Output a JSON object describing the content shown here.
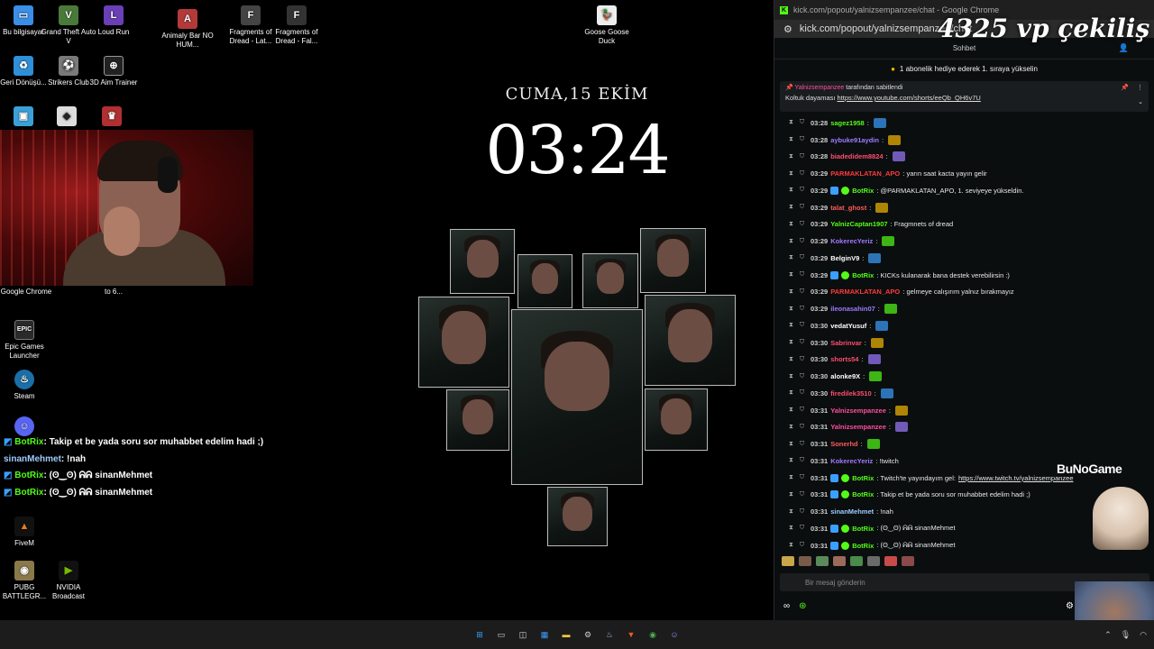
{
  "desktop_icons": [
    {
      "label": "Bu bilgisayar",
      "icon": "computer-icon",
      "color": "#3a8ee6"
    },
    {
      "label": "Grand Theft Auto V",
      "icon": "gta-icon",
      "color": "#4a7a3a"
    },
    {
      "label": "Loud Run",
      "icon": "loud-run-icon",
      "color": "#6b3fb6"
    },
    {
      "label": "Animaly Bar NO HUM...",
      "icon": "animaly-bar-icon",
      "color": "#b43a3a"
    },
    {
      "label": "Fragments of Dread - Lat...",
      "icon": "fragments-icon",
      "color": "#444"
    },
    {
      "label": "Fragments of Dread - Fal...",
      "icon": "fragments-icon",
      "color": "#333"
    },
    {
      "label": "Goose Goose Duck",
      "icon": "goose-icon",
      "color": "#eeeeee"
    },
    {
      "label": "Geri Dönüşü...",
      "icon": "recycle-bin-icon",
      "color": "#2f8fd8"
    },
    {
      "label": "Strikers Club",
      "icon": "strikers-club-icon",
      "color": "#7a7a7a"
    },
    {
      "label": "3D Aim Trainer",
      "icon": "aim-trainer-icon",
      "color": "#222"
    },
    {
      "label": "Google Chrome",
      "icon": "chrome-icon",
      "color": "#4285f4"
    },
    {
      "label": "to 6...",
      "icon": "file-icon",
      "color": "#555"
    },
    {
      "label": "Epic Games Launcher",
      "icon": "epic-icon",
      "color": "#2a2a2a"
    },
    {
      "label": "Steam",
      "icon": "steam-icon",
      "color": "#1b6fa8"
    },
    {
      "label": "FiveM",
      "icon": "fivem-icon",
      "color": "#e67e22"
    },
    {
      "label": "PUBG BATTLEGR...",
      "icon": "pubg-icon",
      "color": "#8a7a4a"
    },
    {
      "label": "NVIDIA Broadcast",
      "icon": "nvidia-icon",
      "color": "#76b900"
    }
  ],
  "overlay_chat": [
    {
      "user": "BotRix",
      "text": ": Takip et be yada soru sor muhabbet edelim hadi ;)"
    },
    {
      "user": "sinanMehmet",
      "text": ": !nah"
    },
    {
      "user": "BotRix",
      "text": ": (ʘ‿ʘ) ᕱᕱ sinanMehmet"
    },
    {
      "user": "BotRix",
      "text": ": (ʘ‿ʘ) ᕱᕱ sinanMehmet"
    }
  ],
  "clock": {
    "date": "CUMA,15 EKİM",
    "time": "03:24"
  },
  "browser": {
    "title": "kick.com/popout/yalnizsempanzee/chat - Google Chrome",
    "url": "kick.com/popout/yalnizsempanzee/chat",
    "tab": "Sohbet",
    "banner": "1 abonelik hediye ederek 1. sıraya yükselin",
    "pinned_by": "Yalnizsempanzee",
    "pinned_by_suffix": "tarafından sabitlendi",
    "pinned_text": "Koltuk dayaması",
    "pinned_link": "https://www.youtube.com/shorts/eeQb_QH6v7U",
    "input_placeholder": "Bir mesaj gönderin"
  },
  "messages": [
    {
      "time": "03:28",
      "user": "sagez1958",
      "color": "#53fc18",
      "text": ":"
    },
    {
      "time": "03:28",
      "user": "aybuke91aydin",
      "color": "#9d7bff",
      "text": ":"
    },
    {
      "time": "03:28",
      "user": "biadedidem8824",
      "color": "#ff4d6d",
      "text": ":"
    },
    {
      "time": "03:29",
      "user": "PARMAKLATAN_APO",
      "color": "#ff3b3b",
      "text": ": yarın saat kacta yayın gelir"
    },
    {
      "time": "03:29",
      "user": "BotRix",
      "color": "#53fc18",
      "text": ": @PARMAKLATAN_APO, 1. seviyeye yükseldin."
    },
    {
      "time": "03:29",
      "user": "talat_ghost",
      "color": "#ff5a5a",
      "text": ":"
    },
    {
      "time": "03:29",
      "user": "YalnizCaptan1907",
      "color": "#53fc18",
      "text": ": Fragmnets of dread"
    },
    {
      "time": "03:29",
      "user": "KokerecYeriz",
      "color": "#9d7bff",
      "text": ":"
    },
    {
      "time": "03:29",
      "user": "BelginV9",
      "color": "#ffffff",
      "text": ":"
    },
    {
      "time": "03:29",
      "user": "BotRix",
      "color": "#53fc18",
      "text": ": KICKs kulanarak bana destek verebilirsin :)"
    },
    {
      "time": "03:29",
      "user": "PARMAKLATAN_APO",
      "color": "#ff3b3b",
      "text": ": gelmeye calışırım yalnız bırakmayız"
    },
    {
      "time": "03:29",
      "user": "ileonasahin07",
      "color": "#9d7bff",
      "text": ":"
    },
    {
      "time": "03:30",
      "user": "vedatYusuf",
      "color": "#ffffff",
      "text": ":"
    },
    {
      "time": "03:30",
      "user": "Sabrinvar",
      "color": "#ff4d6d",
      "text": ":"
    },
    {
      "time": "03:30",
      "user": "shorts54",
      "color": "#ff4d6d",
      "text": ":"
    },
    {
      "time": "03:30",
      "user": "alonke9X",
      "color": "#ffffff",
      "text": ":"
    },
    {
      "time": "03:30",
      "user": "firedilek3510",
      "color": "#ff4d6d",
      "text": ":"
    },
    {
      "time": "03:31",
      "user": "Yalnizsempanzee",
      "color": "#ff4d9d",
      "text": ":"
    },
    {
      "time": "03:31",
      "user": "Yalnizsempanzee",
      "color": "#ff4d9d",
      "text": ":"
    },
    {
      "time": "03:31",
      "user": "Sonerhd",
      "color": "#ff5a5a",
      "text": ":"
    },
    {
      "time": "03:31",
      "user": "KokerecYeriz",
      "color": "#9d7bff",
      "text": ": !twitch"
    },
    {
      "time": "03:31",
      "user": "BotRix",
      "color": "#53fc18",
      "text": ": Twitch'te yayındayım gel: ",
      "link": "https://www.twitch.tv/yalnizsempanzee"
    },
    {
      "time": "03:31",
      "user": "BotRix",
      "color": "#53fc18",
      "text": ": Takip et be yada soru sor muhabbet edelim hadi ;)"
    },
    {
      "time": "03:31",
      "user": "sinanMehmet",
      "color": "#9ecbff",
      "text": ": !nah"
    },
    {
      "time": "03:31",
      "user": "BotRix",
      "color": "#53fc18",
      "text": ": (ʘ‿ʘ) ᕱᕱ sinanMehmet"
    },
    {
      "time": "03:31",
      "user": "BotRix",
      "color": "#53fc18",
      "text": ": (ʘ‿ʘ) ᕱᕱ sinanMehmet"
    }
  ],
  "overlay": {
    "title": "4325 vp çekiliş",
    "brand": "BuNoGame"
  },
  "taskbar_icons": [
    "start-icon",
    "search-icon",
    "task-view-icon",
    "widgets-icon",
    "file-explorer-icon",
    "settings-icon",
    "steam-icon",
    "brave-icon",
    "chrome-icon",
    "discord-icon"
  ],
  "accent": "#53fc18"
}
